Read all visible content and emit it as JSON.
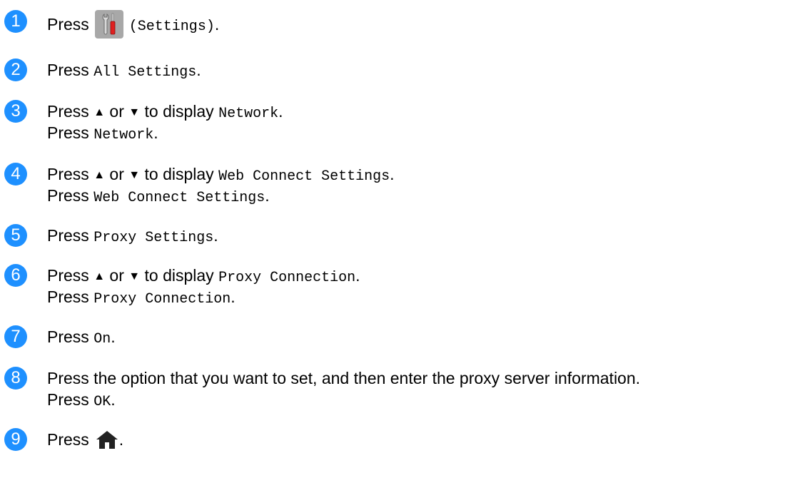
{
  "steps": [
    {
      "number": "1",
      "press": "Press",
      "settings_label": "(Settings)",
      "end": "."
    },
    {
      "number": "2",
      "press": "Press",
      "code": "All Settings",
      "end": "."
    },
    {
      "number": "3",
      "press": "Press",
      "up": "▲",
      "or": "or",
      "down": "▼",
      "to_display": "to display",
      "code": "Network",
      "end": ".",
      "press2": "Press",
      "code2": "Network",
      "end2": "."
    },
    {
      "number": "4",
      "press": "Press",
      "up": "▲",
      "or": "or",
      "down": "▼",
      "to_display": "to display",
      "code": "Web Connect Settings",
      "end": ".",
      "press2": "Press",
      "code2": "Web Connect Settings",
      "end2": "."
    },
    {
      "number": "5",
      "press": "Press",
      "code": "Proxy Settings",
      "end": "."
    },
    {
      "number": "6",
      "press": "Press",
      "up": "▲",
      "or": "or",
      "down": "▼",
      "to_display": "to display",
      "code": "Proxy Connection",
      "end": ".",
      "press2": "Press",
      "code2": "Proxy Connection",
      "end2": "."
    },
    {
      "number": "7",
      "press": "Press",
      "code": "On",
      "end": "."
    },
    {
      "number": "8",
      "text": "Press the option that you want to set, and then enter the proxy server information.",
      "press2": "Press",
      "code2": "OK",
      "end2": "."
    },
    {
      "number": "9",
      "press": "Press",
      "end": "."
    }
  ],
  "icons": {
    "settings": "settings-tools-icon",
    "home": "home-icon"
  },
  "colors": {
    "step_number_bg": "#1e90ff",
    "settings_button_bg": "#a8a8a8",
    "text": "#000000"
  }
}
